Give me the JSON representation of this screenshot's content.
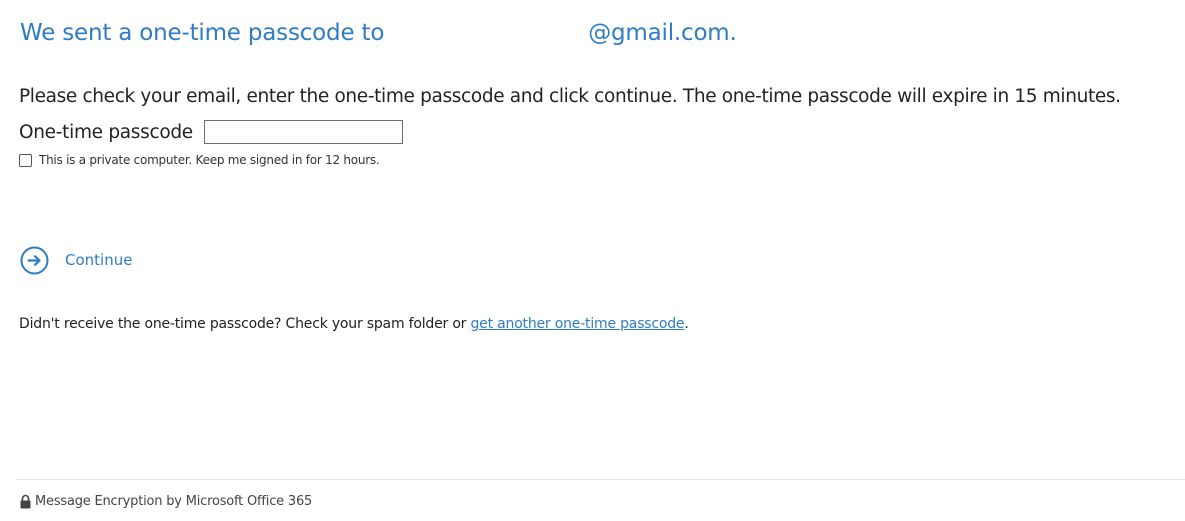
{
  "heading": {
    "prefix": "We sent a one-time passcode to",
    "email_domain": "@gmail.com."
  },
  "instructions": "Please check your email, enter the one-time passcode and click continue. The one-time passcode will expire in 15 minutes.",
  "otp": {
    "label": "One-time passcode",
    "value": "",
    "placeholder": ""
  },
  "keep_signed_in": {
    "label": "This is a private computer. Keep me signed in for 12 hours.",
    "checked": false
  },
  "continue": {
    "label": "Continue",
    "icon": "arrow-right-circle-icon"
  },
  "resend": {
    "text": "Didn't receive the one-time passcode? Check your spam folder or ",
    "link_text": "get another one-time passcode",
    "suffix": "."
  },
  "footer": {
    "icon": "lock-icon",
    "text": "Message Encryption by Microsoft Office 365"
  },
  "colors": {
    "accent": "#2f7cc4",
    "text": "#222222",
    "divider": "#e2e2e2"
  }
}
